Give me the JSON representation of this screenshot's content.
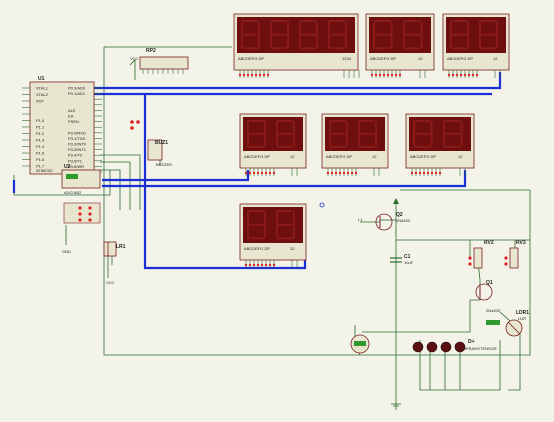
{
  "schematic": {
    "mcu": {
      "ref": "U1",
      "pins_left": [
        "XTAL1",
        "XTAL2",
        "RST",
        "",
        "",
        "P1.0",
        "P1.1",
        "P1.2",
        "P1.3",
        "P1.4",
        "P1.5",
        "P1.6",
        "P1.7"
      ],
      "pins_right": [
        "P0.0/AD0",
        "P0.1/AD1",
        "",
        "",
        "ALE",
        "EA",
        "PSEN",
        "",
        "P3.0/RXD",
        "P3.1/TXD",
        "P3.2/INT0",
        "P3.3/INT1",
        "P3.4/T0",
        "P3.5/T1",
        "P3.6/WR",
        "P3.7/RD"
      ],
      "bottom_label": "AT89C52",
      "u2_ref": "U2",
      "u2_chip": "ADC0832"
    },
    "rp": {
      "ref": "RP2",
      "label": "VCC"
    },
    "buzzer": {
      "ref": "BUZ1",
      "label": "BUZZER"
    },
    "q2": {
      "ref": "Q2",
      "model": "2N4403",
      "input": "L1"
    },
    "q1": {
      "ref": "Q1",
      "model": "2N4403"
    },
    "c1": {
      "ref": "C1",
      "value": "10uF"
    },
    "rv2": {
      "ref": "RV2"
    },
    "rv3": {
      "ref": "RV3"
    },
    "ldr": {
      "ref": "LDR1",
      "label": "LDR"
    },
    "leds": {
      "ref": "D+",
      "label": "INFRAROTENSOR"
    },
    "relay": {
      "ref": "LR1"
    },
    "gnd_label": "GND",
    "vcc_label": "VCC"
  },
  "displays": [
    {
      "name": "display-top-4",
      "digits": 4,
      "pin_labels": "ABCDEFG DP",
      "com_label": "1234"
    },
    {
      "name": "display-top-2a",
      "digits": 2,
      "pin_labels": "ABCDEFG DP",
      "com_label": "12"
    },
    {
      "name": "display-top-2b",
      "digits": 2,
      "pin_labels": "ABCDEFG DP",
      "com_label": "12"
    },
    {
      "name": "display-mid-1",
      "digits": 2,
      "pin_labels": "ABCDEFG DP",
      "com_label": "12"
    },
    {
      "name": "display-mid-2",
      "digits": 2,
      "pin_labels": "ABCDEFG DP",
      "com_label": "12"
    },
    {
      "name": "display-mid-3",
      "digits": 2,
      "pin_labels": "ABCDEFG DP",
      "com_label": "12"
    },
    {
      "name": "display-bottom",
      "digits": 2,
      "pin_labels": "ABCDEFG DP",
      "com_label": "12"
    }
  ],
  "colors": {
    "bus": "#1a2fd6",
    "wire": "#2b6b2b",
    "segment_bg": "#6e0f0f",
    "segment_on": "#8a1a1a",
    "body": "#e9e6cf"
  }
}
